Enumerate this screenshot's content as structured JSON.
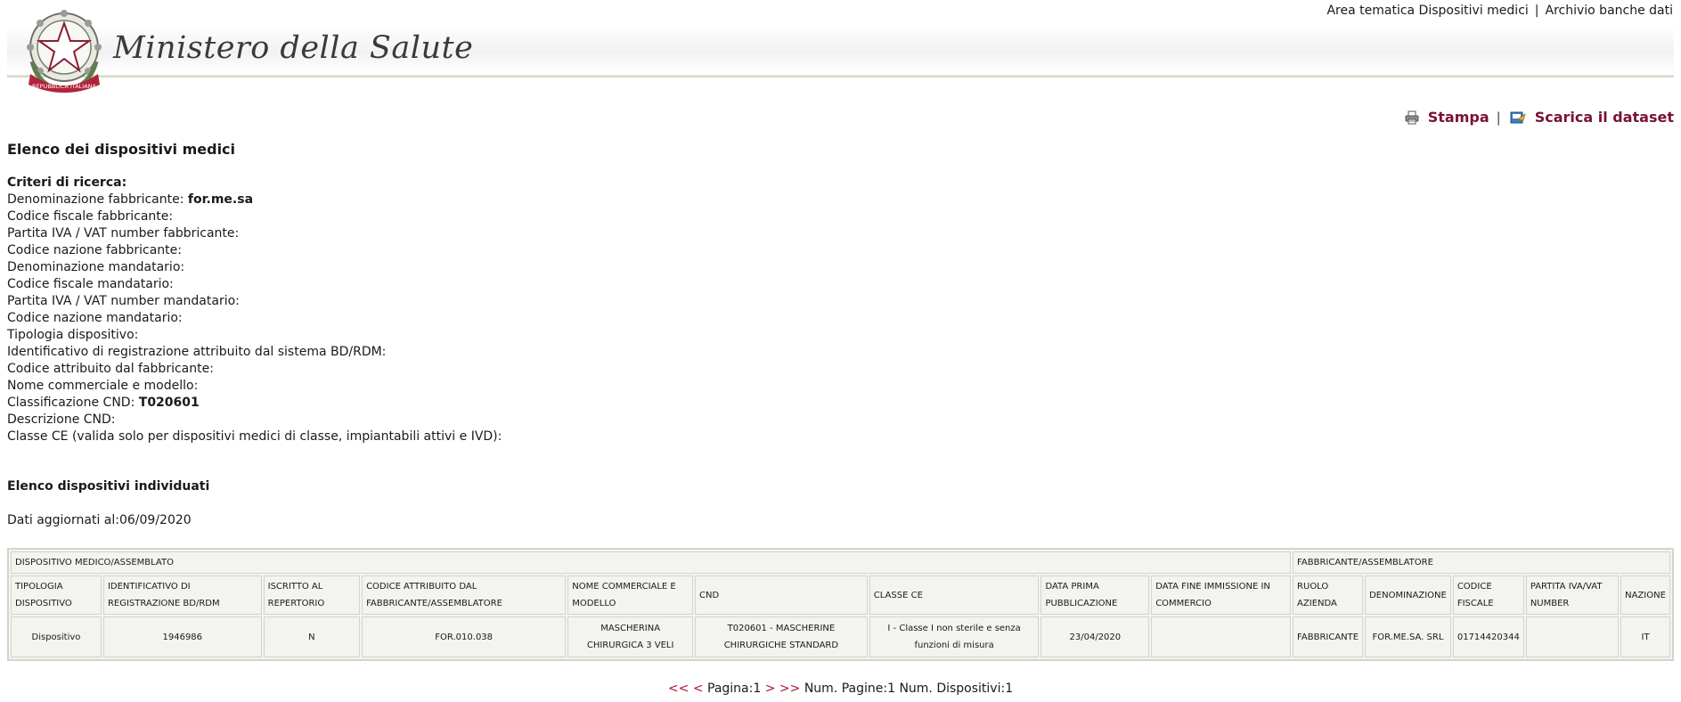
{
  "header": {
    "top_links": [
      "Area tematica Dispositivi medici",
      "Archivio banche dati"
    ],
    "separator": "|",
    "brand": "Ministero della Salute",
    "emblem_text": "REPUBBLICA ITALIANA"
  },
  "actions": {
    "print_label": "Stampa",
    "separator": "|",
    "download_label": "Scarica il dataset"
  },
  "page_title": "Elenco dei dispositivi medici",
  "criteria": {
    "heading": "Criteri di ricerca:",
    "rows": [
      {
        "label": "Denominazione fabbricante: ",
        "value": "for.me.sa"
      },
      {
        "label": "Codice fiscale fabbricante:",
        "value": ""
      },
      {
        "label": "Partita IVA / VAT number fabbricante:",
        "value": ""
      },
      {
        "label": "Codice nazione fabbricante:",
        "value": ""
      },
      {
        "label": "Denominazione mandatario:",
        "value": ""
      },
      {
        "label": "Codice fiscale mandatario:",
        "value": ""
      },
      {
        "label": "Partita IVA / VAT number mandatario:",
        "value": ""
      },
      {
        "label": "Codice nazione mandatario:",
        "value": ""
      },
      {
        "label": "Tipologia dispositivo:",
        "value": ""
      },
      {
        "label": "Identificativo di registrazione attribuito dal sistema BD/RDM:",
        "value": ""
      },
      {
        "label": "Codice attribuito dal fabbricante:",
        "value": ""
      },
      {
        "label": "Nome commerciale e modello:",
        "value": ""
      },
      {
        "label": "Classificazione CND: ",
        "value": "T020601"
      },
      {
        "label": "Descrizione CND:",
        "value": ""
      },
      {
        "label": "Classe CE (valida solo per dispositivi medici di classe, impiantabili attivi e IVD):",
        "value": ""
      }
    ]
  },
  "results_title": "Elenco dispositivi individuati",
  "updated": "Dati aggiornati al:06/09/2020",
  "table": {
    "groups": [
      "DISPOSITIVO MEDICO/ASSEMBLATO",
      "FABBRICANTE/ASSEMBLATORE"
    ],
    "columns": [
      "TIPOLOGIA DISPOSITIVO",
      "IDENTIFICATIVO DI REGISTRAZIONE BD/RDM",
      "ISCRITTO AL REPERTORIO",
      "CODICE ATTRIBUITO DAL FABBRICANTE/ASSEMBLATORE",
      "NOME COMMERCIALE E MODELLO",
      "CND",
      "CLASSE CE",
      "DATA PRIMA PUBBLICAZIONE",
      "DATA FINE IMMISSIONE IN COMMERCIO",
      "RUOLO AZIENDA",
      "DENOMINAZIONE",
      "CODICE FISCALE",
      "PARTITA IVA/VAT NUMBER",
      "NAZIONE"
    ],
    "rows": [
      [
        "Dispositivo",
        "1946986",
        "N",
        "FOR.010.038",
        "MASCHERINA CHIRURGICA 3 VELI",
        "T020601 - MASCHERINE CHIRURGICHE STANDARD",
        "I - Classe I non sterile e senza funzioni di misura",
        "23/04/2020",
        "",
        "FABBRICANTE",
        "FOR.ME.SA. SRL",
        "01714420344",
        "",
        "IT"
      ]
    ]
  },
  "pager": {
    "first": "<<",
    "prev": "<",
    "page_text": "Pagina:1",
    "next": ">",
    "last": ">>",
    "pages_text": "Num. Pagine:1",
    "devices_text": "Num. Dispositivi:1"
  },
  "colors": {
    "link": "#7a1230",
    "pager_link": "#b3123a",
    "table_bg": "#f3f3ef",
    "table_border": "#d4d4ce"
  }
}
